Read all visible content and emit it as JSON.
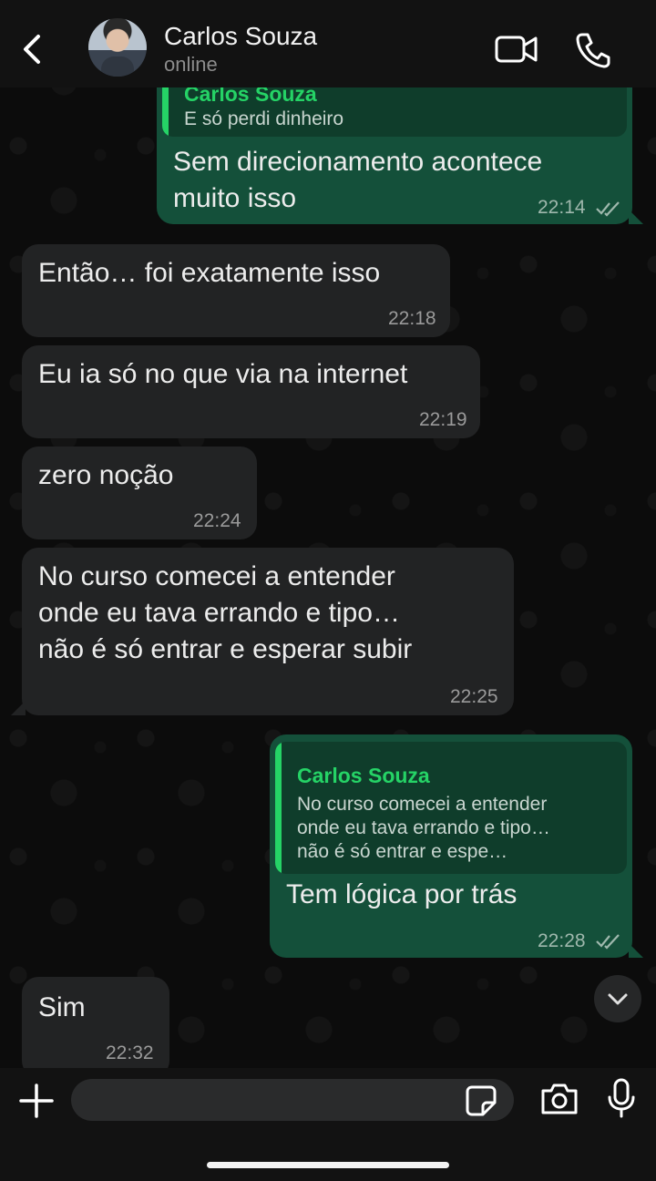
{
  "header": {
    "contact_name": "Carlos Souza",
    "contact_status": "online"
  },
  "messages": [
    {
      "direction": "outgoing",
      "quote_name": "Carlos Souza",
      "quote_text": "E só perdi dinheiro",
      "text": "Sem direcionamento acontece\nmuito isso",
      "time": "22:14",
      "read": true
    },
    {
      "direction": "incoming",
      "text": "Então… foi exatamente isso",
      "time": "22:18"
    },
    {
      "direction": "incoming",
      "text": "Eu ia só no que via na internet",
      "time": "22:19"
    },
    {
      "direction": "incoming",
      "text": "zero noção",
      "time": "22:24"
    },
    {
      "direction": "incoming",
      "text": "No curso comecei a entender\nonde eu tava errando e tipo…\nnão é só entrar e esperar subir",
      "time": "22:25"
    },
    {
      "direction": "outgoing",
      "quote_name": "Carlos Souza",
      "quote_text": "No curso comecei a entender\nonde eu tava errando e tipo…\nnão é só entrar e espe…",
      "text": "Tem lógica por trás",
      "time": "22:28",
      "read": true
    },
    {
      "direction": "incoming",
      "text": "Sim",
      "time": "22:32"
    }
  ],
  "composer": {
    "value": "",
    "placeholder": ""
  },
  "colors": {
    "outgoing_bubble": "#14503a",
    "incoming_bubble": "#222324",
    "accent_green": "#25d366",
    "read_ticks": "#9fb8ad"
  },
  "icons": [
    "back-arrow-icon",
    "video-camera-icon",
    "phone-icon",
    "chevron-down-icon",
    "plus-icon",
    "sticker-icon",
    "camera-icon",
    "microphone-icon",
    "double-check-icon"
  ]
}
